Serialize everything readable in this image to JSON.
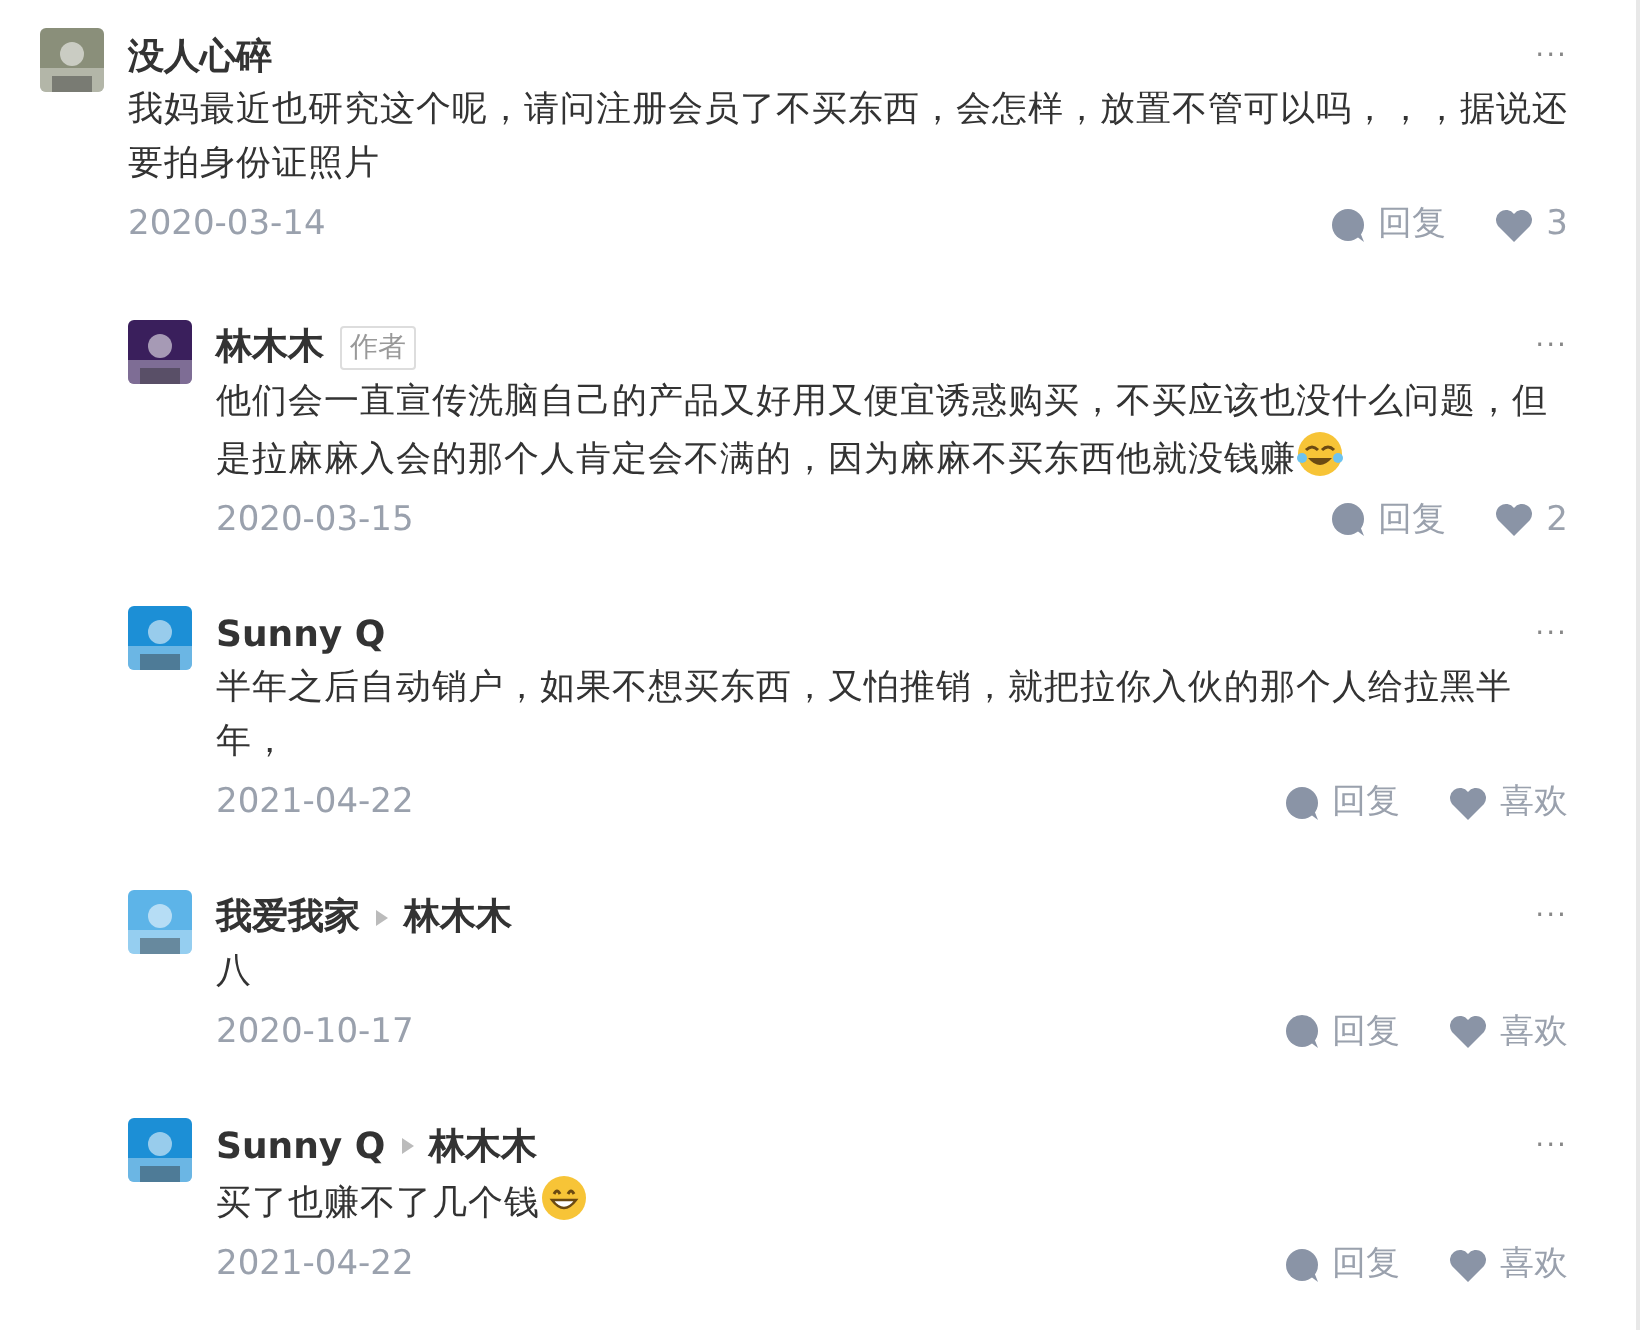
{
  "comments": [
    {
      "author": "没人心碎",
      "text": "我妈最近也研究这个呢，请问注册会员了不买东西，会怎样，放置不管可以吗，，，据说还要拍身份证照片",
      "date": "2020-03-14",
      "more": "···",
      "reply_label": "回复",
      "like_label": "3",
      "replies": [
        {
          "author": "林木木",
          "badge": "作者",
          "text": "他们会一直宣传洗脑自己的产品又好用又便宜诱惑购买，不买应该也没什么问题，但是拉麻麻入会的那个人肯定会不满的，因为麻麻不买东西他就没钱赚",
          "emoji": {
            "kind": "tears"
          },
          "date": "2020-03-15",
          "more": "···",
          "reply_label": "回复",
          "like_label": "2"
        },
        {
          "author": "Sunny Q",
          "text": "半年之后自动销户，如果不想买东西，又怕推销，就把拉你入伙的那个人给拉黑半年，",
          "date": "2021-04-22",
          "more": "···",
          "reply_label": "回复",
          "like_label": "喜欢"
        },
        {
          "author": "我爱我家",
          "reply_to": "林木木",
          "text": "八",
          "date": "2020-10-17",
          "more": "···",
          "reply_label": "回复",
          "like_label": "喜欢"
        },
        {
          "author": "Sunny Q",
          "reply_to": "林木木",
          "text": "买了也赚不了几个钱",
          "emoji": {
            "kind": "grin"
          },
          "date": "2021-04-22",
          "more": "···",
          "reply_label": "回复",
          "like_label": "喜欢"
        }
      ]
    }
  ]
}
